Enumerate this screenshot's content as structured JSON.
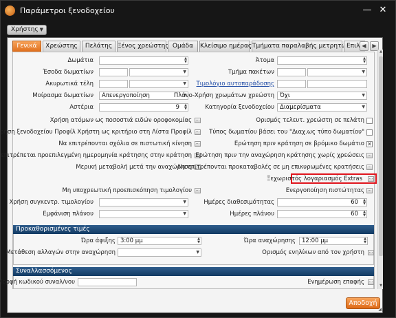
{
  "window": {
    "title": "Παράμετροι ξενοδοχείου"
  },
  "user_menu": {
    "label": "Χρήστης"
  },
  "tabs": [
    "Γενικά",
    "Χρεώστης",
    "Πελάτης",
    "Ξένος χρεώστης",
    "Ομάδα",
    "Κλείσιμο ημέρας",
    "Τμήματα παραλαβής μετρητών",
    "Επιλογ"
  ],
  "general": {
    "rooms": {
      "label": "Δωμάτια",
      "value": ""
    },
    "persons": {
      "label": "Άτομα",
      "value": ""
    },
    "room_revenue": {
      "label": "Έσοδα δωματίων"
    },
    "package_part": {
      "label": "Τμήμα πακέτων"
    },
    "cancellation_fees": {
      "label": "Ακυρωτικά τέλη"
    },
    "self_invoice_pricelist": {
      "label": "Τιμολόγιο αυτοπαράδοσης"
    },
    "room_share": {
      "label": "Μοίρασμα δωματίων",
      "value": "Απενεργοποίηση"
    },
    "plan_color_use": {
      "label": "Πλάνο-Χρήση χρωμάτων χρεώστη",
      "value": "Όχι"
    },
    "stars": {
      "label": "Αστέρια",
      "value": "9"
    },
    "hotel_category": {
      "label": "Κατηγορία ξενοδοχείου",
      "value": "Διαμερίσματα"
    }
  },
  "options_left": [
    "Χρήση ατόμων ως ποσοστιά ειδών οροφοκομίας",
    "Χρήση ξενοδοχείου Προφίλ Χρήστη ως κριτήριο στη Λίστα Προφίλ",
    "Να επιτρέπονται σχόλια σε πιστωτική κίνηση",
    "Να επιτρέπεται προεπιλεγμένη ημερομηνία κράτησης στην κράτηση",
    "Μερική μεταβολή μετά την αναχώρηση"
  ],
  "options_right": [
    {
      "label": "Ορισμός τελευτ. χρεώστη σε πελάτη",
      "checked": false
    },
    {
      "label": "Τύπος δωματίου βάσει του \"Διαχ.ως τύπο δωματίου\"",
      "checked": false
    },
    {
      "label": "Ερώτηση πριν κράτηση σε βρόμικο δωμάτιο",
      "checked": true
    },
    {
      "label": "Ερώτηση πριν την αναχώρηση κράτησης χωρίς χρεώσεις",
      "checked": false
    },
    {
      "label": "Να επιτρέπονται προκαταβολές σε μη επικυρωμένες κρατήσεις",
      "checked": false
    }
  ],
  "extras_account": {
    "label": "Ξεχωριστός λογαριασμός Extras"
  },
  "optional_invoice_preview": {
    "label": "Μη υποχρεωτική προεπισκόπηση τιμολογίου"
  },
  "credit_activation": {
    "label": "Ενεργοποίηση πιστώτητας"
  },
  "consolidated_invoice": {
    "label": "Χρήση συγκεντρ. τιμολογίου",
    "value": ""
  },
  "availability_days": {
    "label": "Ημέρες διαθεσιμότητας",
    "value": "60"
  },
  "plan_display": {
    "label": "Εμφάνιση πλάνου",
    "value": ""
  },
  "plan_days": {
    "label": "Ημέρες πλάνου",
    "value": "60"
  },
  "predefined_times": {
    "title": "Προκαθορισμένες τιμές",
    "arrival_time": {
      "label": "Ώρα άφιξης",
      "value": "3:00 μμ"
    },
    "departure_time": {
      "label": "Ώρα αναχώρησης",
      "value": "12:00 μμ"
    },
    "change_transfer": {
      "label": "Μετάθεση αλλαγών στην αναχώρηση",
      "value": ""
    },
    "adults_by_user": {
      "label": "Ορισμός ενηλίκων από τον χρήστη"
    }
  },
  "sync": {
    "title": "Συναλλασσόμενος",
    "code_format": {
      "label": "Μορφή κωδικού συναλ/νου",
      "value": ""
    },
    "contact_update": {
      "label": "Ενημέρωση επαφής"
    }
  },
  "actions": {
    "accept": "Αποδοχή"
  },
  "colors": {
    "accent": "#e87a27",
    "section": "#1f4872",
    "highlight": "#e0141c"
  }
}
